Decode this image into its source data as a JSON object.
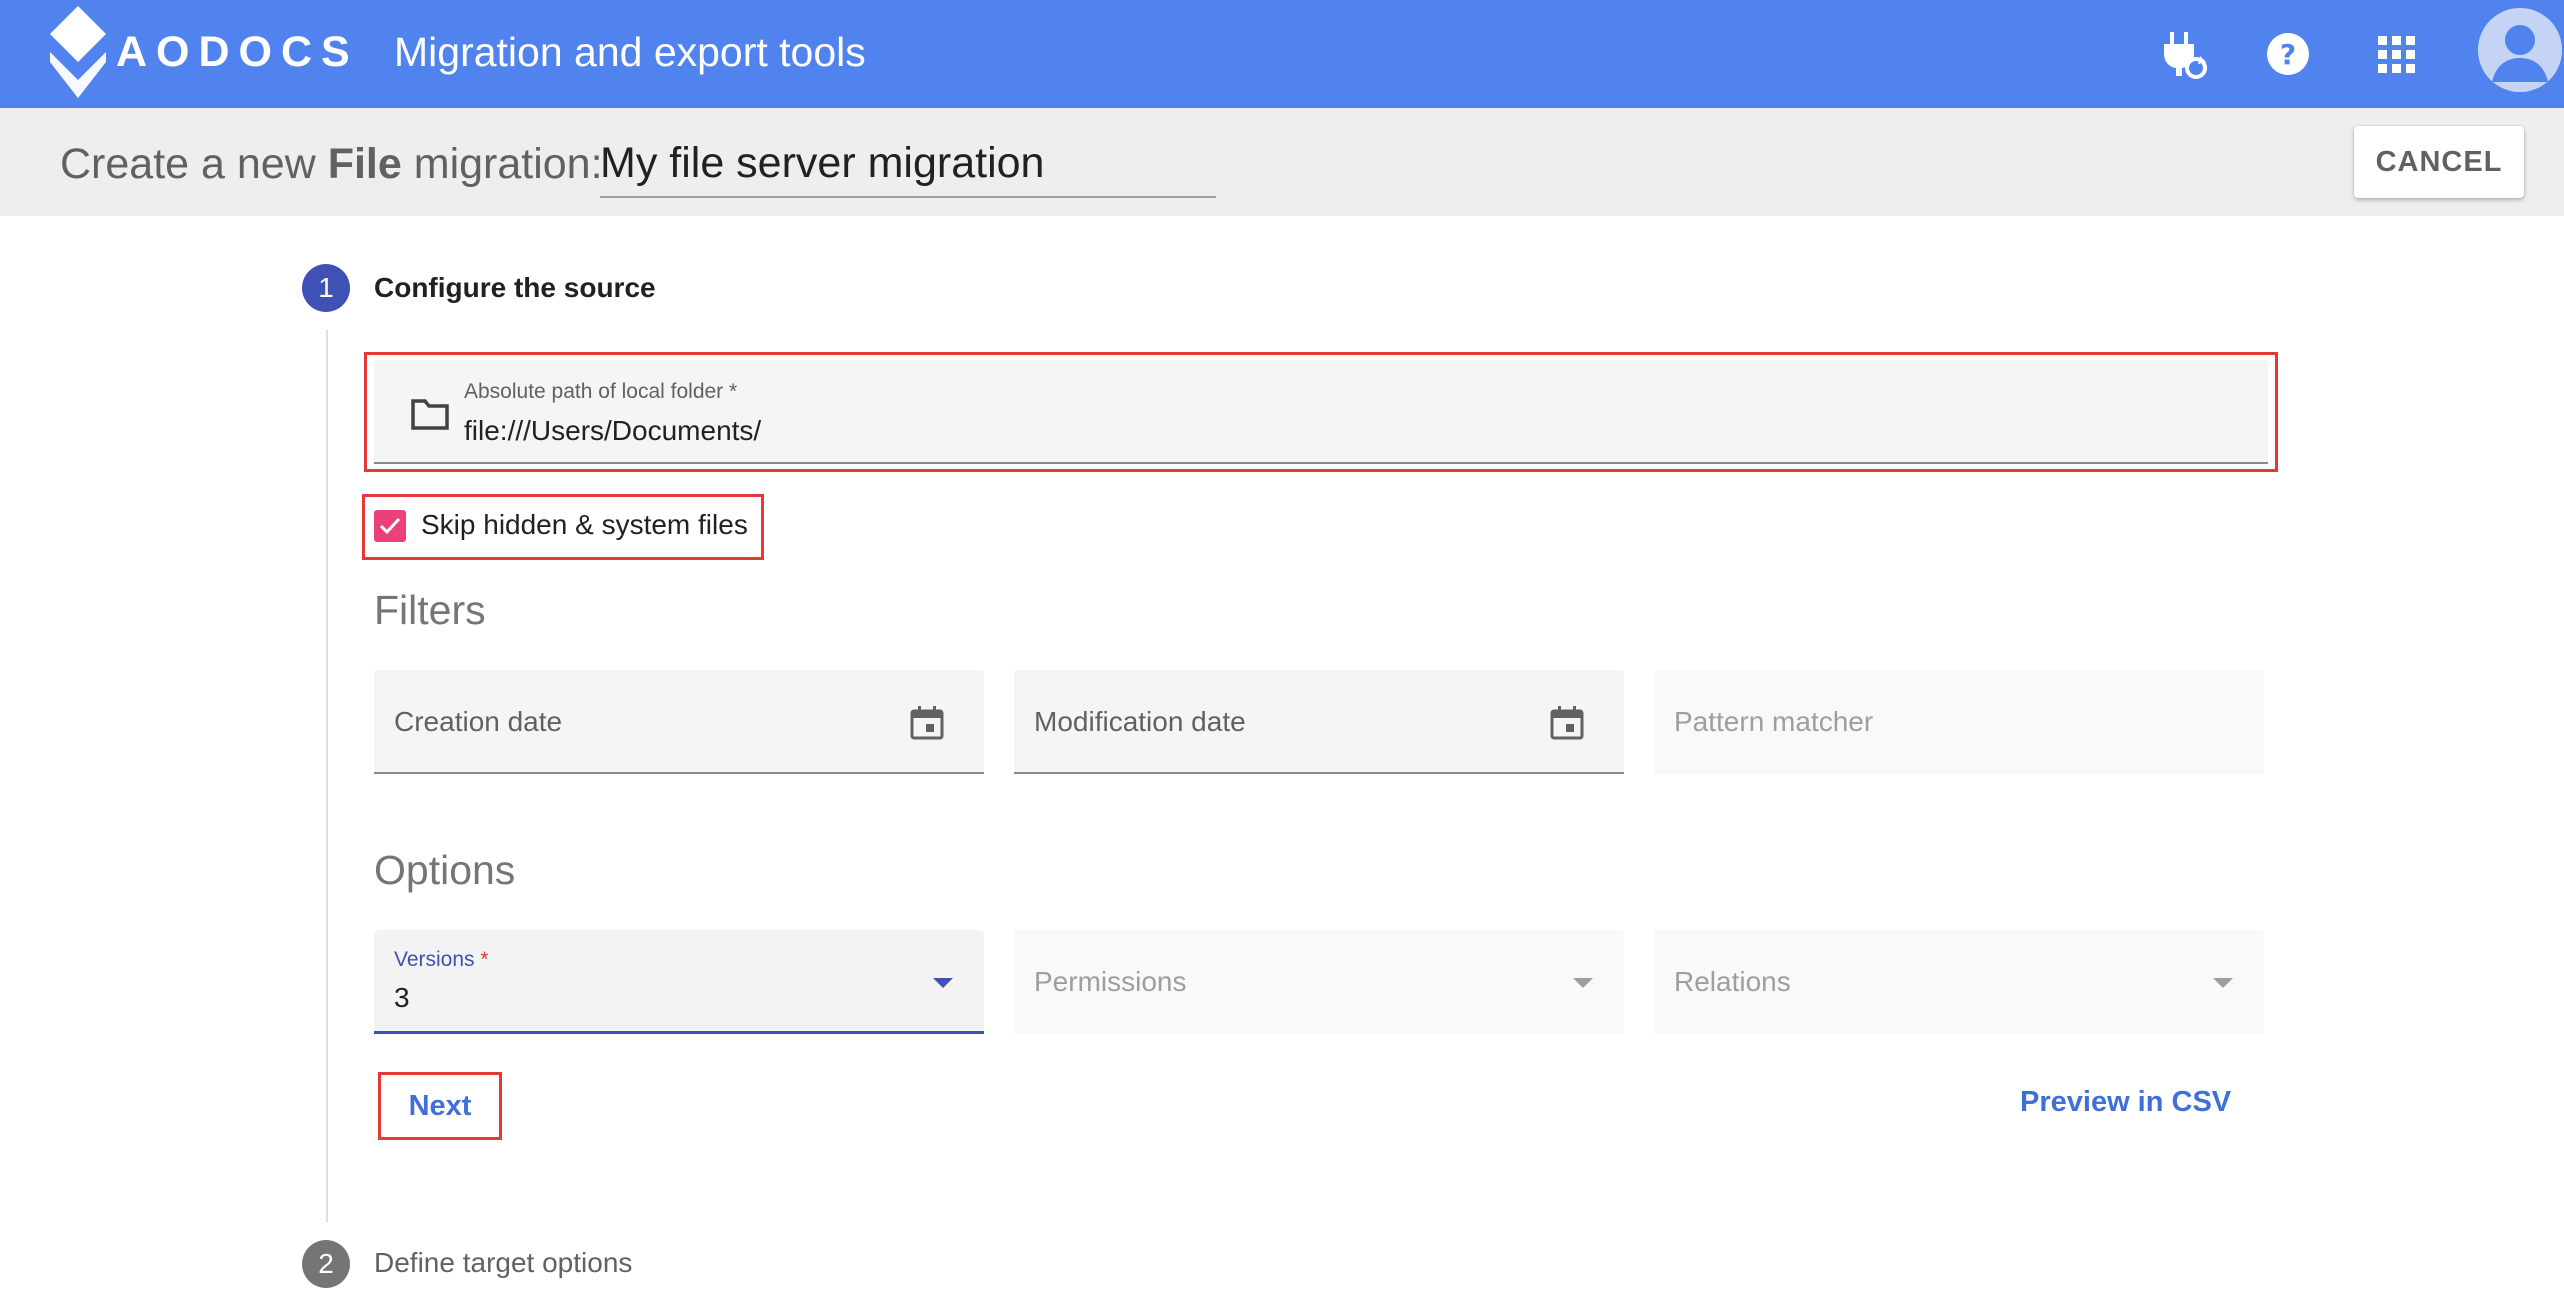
{
  "appbar": {
    "brand": "AODOCS",
    "title": "Migration and export tools",
    "icons": [
      "plug-refresh-icon",
      "help-icon",
      "apps-grid-icon",
      "account-avatar-icon"
    ],
    "color": "#5083ee"
  },
  "header": {
    "title_prefix": "Create a new",
    "title_bold": "File",
    "title_suffix": "migration:",
    "migration_name": "My file server migration",
    "cancel_label": "CANCEL"
  },
  "steps": [
    {
      "number": "1",
      "label": "Configure the source",
      "active": true
    },
    {
      "number": "2",
      "label": "Define target options",
      "active": false
    }
  ],
  "source": {
    "path_label": "Absolute path of local folder *",
    "path_value": "file:///Users/Documents/",
    "skip_hidden_label": "Skip hidden & system files",
    "skip_hidden_checked": true
  },
  "filters": {
    "title": "Filters",
    "creation_date": "Creation date",
    "modification_date": "Modification date",
    "pattern_matcher": "Pattern matcher"
  },
  "options": {
    "title": "Options",
    "versions_label": "Versions",
    "versions_required": "*",
    "versions_value": "3",
    "permissions_label": "Permissions",
    "relations_label": "Relations"
  },
  "actions": {
    "next_label": "Next",
    "preview_label": "Preview in CSV"
  },
  "colors": {
    "primary": "#3f51b5",
    "link": "#3f6fd8",
    "checkbox": "#ec407a",
    "highlight": "#e53935"
  }
}
